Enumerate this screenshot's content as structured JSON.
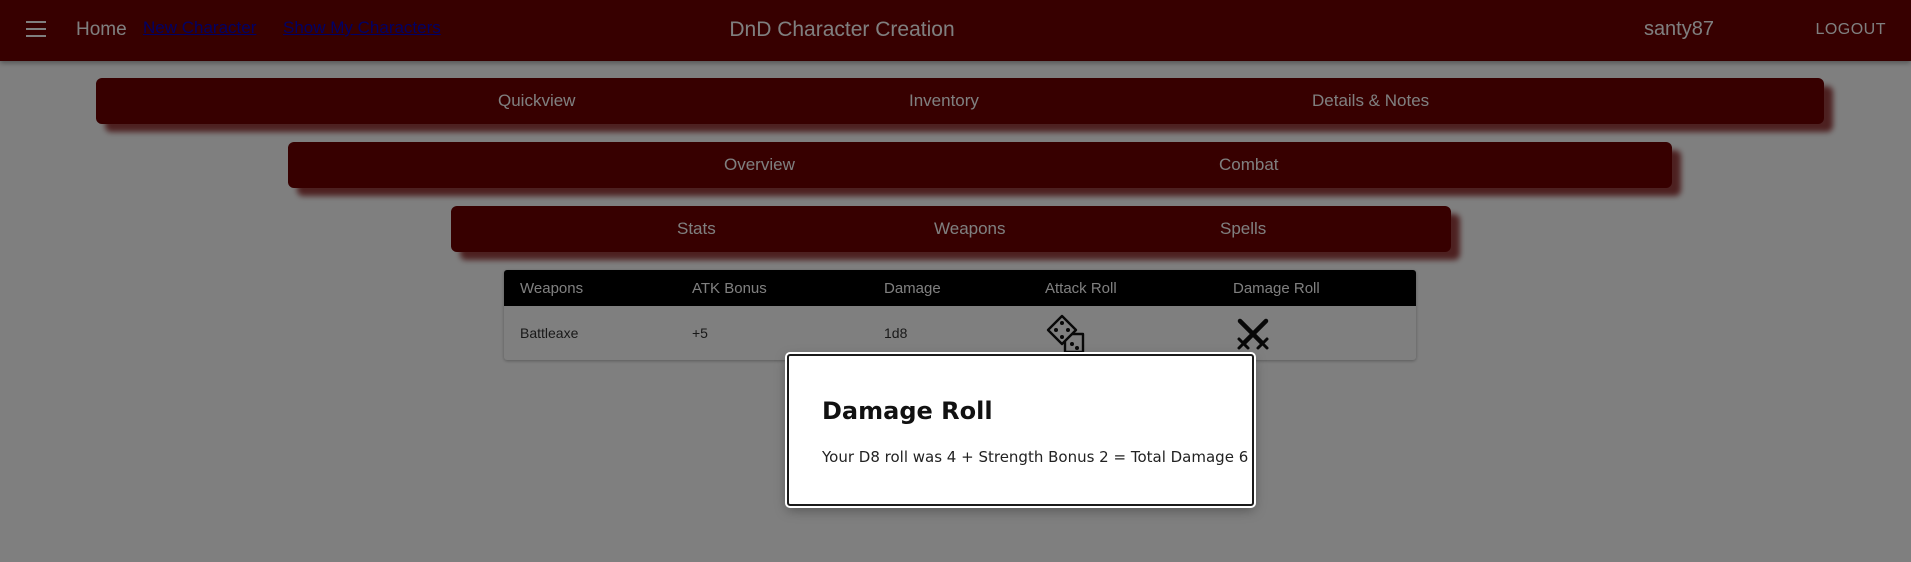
{
  "header": {
    "home_label": "Home",
    "new_character_label": "New Character",
    "show_characters_label": "Show My Characters",
    "title": "DnD Character Creation",
    "username": "santy87",
    "logout_label": "LOGOUT"
  },
  "tabs": {
    "primary": [
      "Quickview",
      "Inventory",
      "Details & Notes"
    ],
    "secondary": [
      "Overview",
      "Combat"
    ],
    "tertiary": [
      "Stats",
      "Weapons",
      "Spells"
    ]
  },
  "weapons_table": {
    "headers": [
      "Weapons",
      "ATK Bonus",
      "Damage",
      "Attack Roll",
      "Damage Roll"
    ],
    "rows": [
      {
        "weapon": "Battleaxe",
        "atk_bonus": "+5",
        "damage": "1d8",
        "attack_roll_icon": "dice-icon",
        "damage_roll_icon": "crossed-swords-icon"
      }
    ]
  },
  "dialog": {
    "title": "Damage Roll",
    "message": "Your D8 roll was 4 + Strength Bonus 2 = Total Damage 6"
  },
  "colors": {
    "primary": "#6e0000",
    "table_header": "#000000",
    "backdrop": "rgba(0,0,0,0.5)"
  }
}
